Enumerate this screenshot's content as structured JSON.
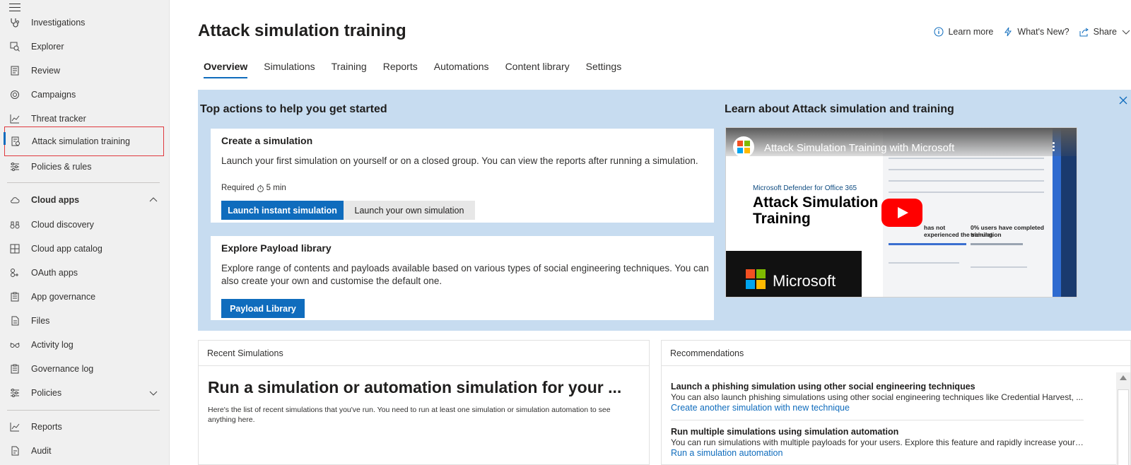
{
  "sidebar": {
    "items": [
      {
        "label": "Investigations",
        "icon": "investigations-icon"
      },
      {
        "label": "Explorer",
        "icon": "explorer-icon"
      },
      {
        "label": "Review",
        "icon": "review-icon"
      },
      {
        "label": "Campaigns",
        "icon": "campaigns-icon"
      },
      {
        "label": "Threat tracker",
        "icon": "chart-line-icon"
      },
      {
        "label": "Attack simulation training",
        "icon": "simulation-icon",
        "selected": true
      },
      {
        "label": "Policies & rules",
        "icon": "sliders-icon"
      },
      {
        "label": "Cloud apps",
        "icon": "cloud-icon"
      },
      {
        "label": "Cloud discovery",
        "icon": "binoculars-icon"
      },
      {
        "label": "Cloud app catalog",
        "icon": "grid-icon"
      },
      {
        "label": "OAuth apps",
        "icon": "oauth-icon"
      },
      {
        "label": "App governance",
        "icon": "clipboard-icon"
      },
      {
        "label": "Files",
        "icon": "file-icon"
      },
      {
        "label": "Activity log",
        "icon": "glasses-icon"
      },
      {
        "label": "Governance log",
        "icon": "clipboard-icon"
      },
      {
        "label": "Policies",
        "icon": "sliders-icon"
      },
      {
        "label": "Reports",
        "icon": "chart-line-icon"
      },
      {
        "label": "Audit",
        "icon": "audit-icon"
      }
    ]
  },
  "header": {
    "title": "Attack simulation training",
    "learn_more": "Learn more",
    "whats_new": "What's New?",
    "share": "Share"
  },
  "tabs": [
    "Overview",
    "Simulations",
    "Training",
    "Reports",
    "Automations",
    "Content library",
    "Settings"
  ],
  "active_tab": "Overview",
  "banner": {
    "left_title": "Top actions to help you get started",
    "right_title": "Learn about Attack simulation and training",
    "card1": {
      "title": "Create a simulation",
      "text": "Launch your first simulation on yourself or on a closed group. You can view the reports after running a simulation.",
      "required": "Required",
      "duration": "5 min",
      "primary": "Launch instant simulation",
      "secondary": "Launch your own simulation"
    },
    "card2": {
      "title": "Explore Payload library",
      "text": "Explore range of contents and payloads available based on various types of social engineering techniques. You can also create your own and customise the default one.",
      "primary": "Payload Library"
    },
    "video": {
      "title": "Attack Simulation Training with Microsoft",
      "subtitle": "Microsoft Defender for Office 365",
      "big_line1": "Attack Simulation",
      "big_line2": "Training",
      "brand": "Microsoft",
      "stat1_line1": "has not",
      "stat1_line2": "experienced the simulation",
      "stat2_line1": "0% users have completed",
      "stat2_line2": "training"
    }
  },
  "recent": {
    "header": "Recent Simulations",
    "big": "Run a simulation or automation simulation for your ...",
    "small": "Here's the list of recent simulations that you've run. You need to run at least one simulation or simulation automation to see anything here."
  },
  "recommendations": {
    "header": "Recommendations",
    "items": [
      {
        "title": "Launch a phishing simulation using other social engineering techniques",
        "desc": "You can also launch phishing simulations using other social engineering techniques like Credential Harvest, ...",
        "link": "Create another simulation with new technique"
      },
      {
        "title": "Run multiple simulations using simulation automation",
        "desc": "You can run simulations with multiple payloads for your users. Explore this feature and rapidly increase your s...",
        "link": "Run a simulation automation"
      }
    ]
  },
  "colors": {
    "accent": "#0f6cbd",
    "banner": "#c7dcf0",
    "selected_outline": "#e0393e"
  }
}
